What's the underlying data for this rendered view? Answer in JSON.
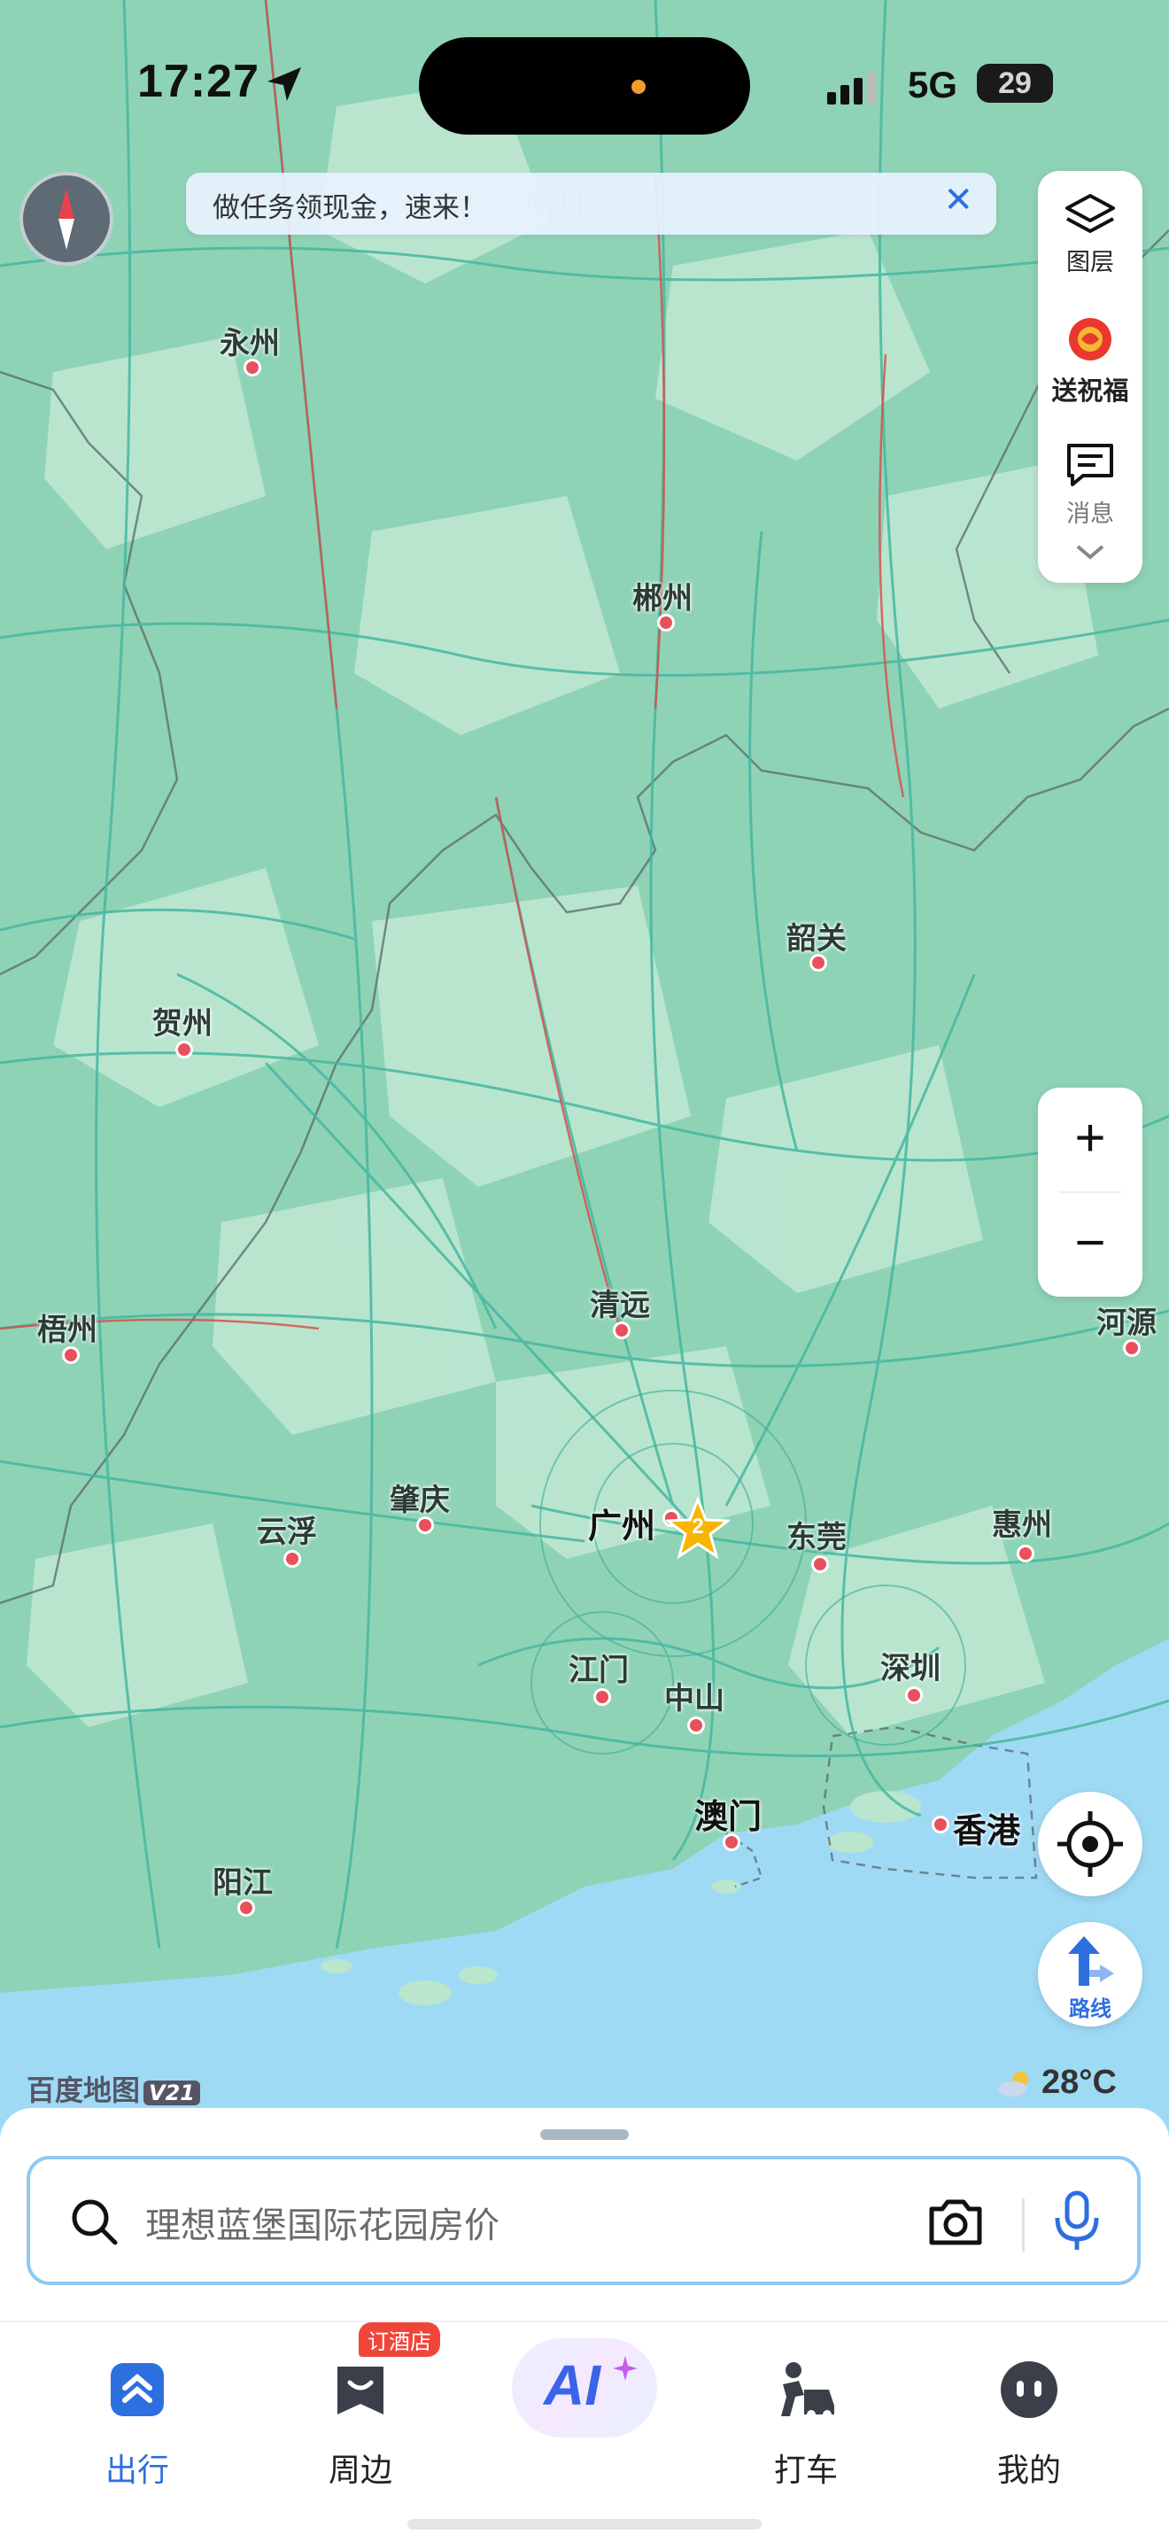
{
  "status_bar": {
    "time": "17:27",
    "network": "5G",
    "battery": "29"
  },
  "banner": {
    "text": "做任务领现金，速来！"
  },
  "right_panel": {
    "layers_label": "图层",
    "blessing_label": "送祝福",
    "messages_label": "消息"
  },
  "zoom": {
    "in_symbol": "+",
    "out_symbol": "−"
  },
  "route_button": {
    "label": "路线"
  },
  "map": {
    "watermark": "百度地图",
    "version": "V21",
    "weather_temp": "28°C",
    "faded_label": "衡阳",
    "cluster_count": "2",
    "cities": [
      {
        "name": "永州"
      },
      {
        "name": "郴州"
      },
      {
        "name": "韶关"
      },
      {
        "name": "贺州"
      },
      {
        "name": "清远"
      },
      {
        "name": "梧州"
      },
      {
        "name": "河源"
      },
      {
        "name": "肇庆"
      },
      {
        "name": "广州"
      },
      {
        "name": "云浮"
      },
      {
        "name": "东莞"
      },
      {
        "name": "惠州"
      },
      {
        "name": "江门"
      },
      {
        "name": "深圳"
      },
      {
        "name": "中山"
      },
      {
        "name": "澳门"
      },
      {
        "name": "香港"
      },
      {
        "name": "阳江"
      }
    ]
  },
  "search": {
    "placeholder": "理想蓝堡国际花园房价"
  },
  "tabs": [
    {
      "label": "出行",
      "active": true
    },
    {
      "label": "周边",
      "badge": "订酒店"
    },
    {
      "label": "AI"
    },
    {
      "label": "打车"
    },
    {
      "label": "我的"
    }
  ],
  "colors": {
    "accent": "#2e6fe0",
    "badge": "#f0463a",
    "land": "#8fd3b6",
    "water": "#9fdaf5"
  }
}
